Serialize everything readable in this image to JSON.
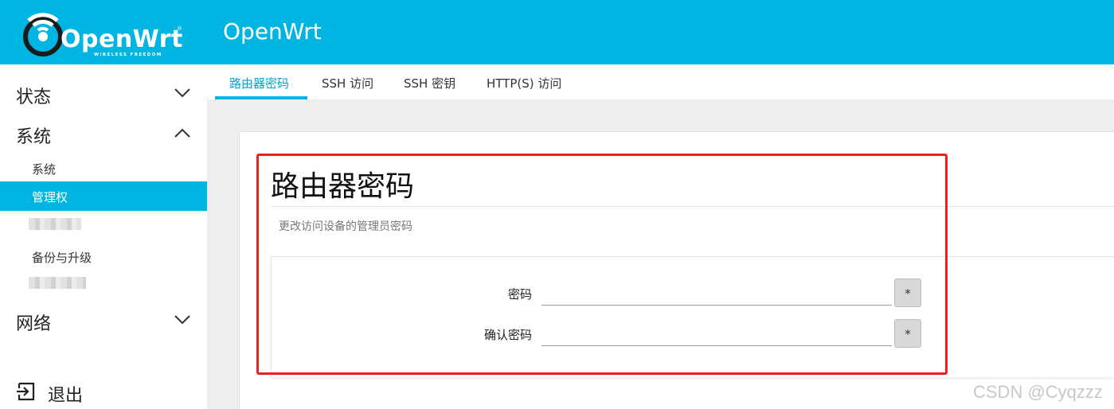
{
  "header": {
    "logo_word": "OpenWrt",
    "logo_tagline": "WIRELESS FREEDOM",
    "logo_reg": "®",
    "brand": "OpenWrt"
  },
  "sidebar": {
    "status": "状态",
    "system": "系统",
    "system_items": [
      "系统",
      "管理权",
      "备份与升级"
    ],
    "network": "网络",
    "logout": "退出"
  },
  "tabs": [
    "路由器密码",
    "SSH 访问",
    "SSH 密钥",
    "HTTP(S) 访问"
  ],
  "page": {
    "title": "路由器密码",
    "description": "更改访问设备的管理员密码",
    "password_label": "密码",
    "confirm_label": "确认密码",
    "reveal_symbol": "*"
  },
  "watermark": "CSDN @Cyqzzz",
  "colors": {
    "accent": "#00b5e2",
    "highlight": "#e8231d"
  }
}
